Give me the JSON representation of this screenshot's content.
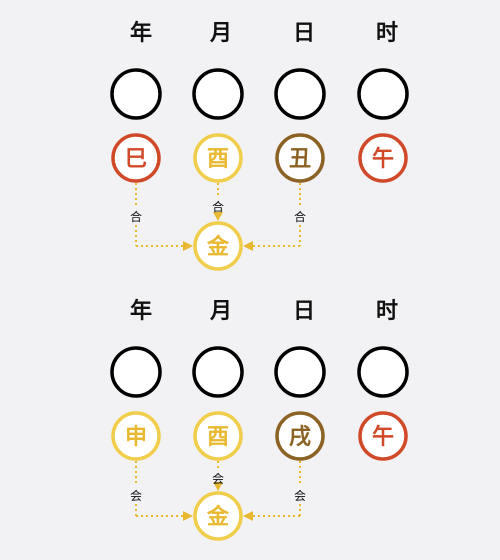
{
  "colors": {
    "background": "#f2f2f5",
    "fire": "#d04a2a",
    "metal": "#f0cd4a",
    "earth": "#8b6223",
    "connector": "#e8b830"
  },
  "diagrams": [
    {
      "headers": [
        "年",
        "月",
        "日",
        "时"
      ],
      "stems": [
        "",
        "",
        "",
        ""
      ],
      "branches": [
        {
          "char": "巳",
          "element": "fire"
        },
        {
          "char": "酉",
          "element": "metal"
        },
        {
          "char": "丑",
          "element": "earth"
        },
        {
          "char": "午",
          "element": "fire"
        }
      ],
      "labels": [
        "合",
        "合",
        "合"
      ],
      "result": {
        "char": "金",
        "element": "metal"
      }
    },
    {
      "headers": [
        "年",
        "月",
        "日",
        "时"
      ],
      "stems": [
        "",
        "",
        "",
        ""
      ],
      "branches": [
        {
          "char": "申",
          "element": "metal"
        },
        {
          "char": "酉",
          "element": "metal"
        },
        {
          "char": "戌",
          "element": "earth"
        },
        {
          "char": "午",
          "element": "fire"
        }
      ],
      "labels": [
        "会",
        "会",
        "会"
      ],
      "result": {
        "char": "金",
        "element": "metal"
      }
    }
  ]
}
